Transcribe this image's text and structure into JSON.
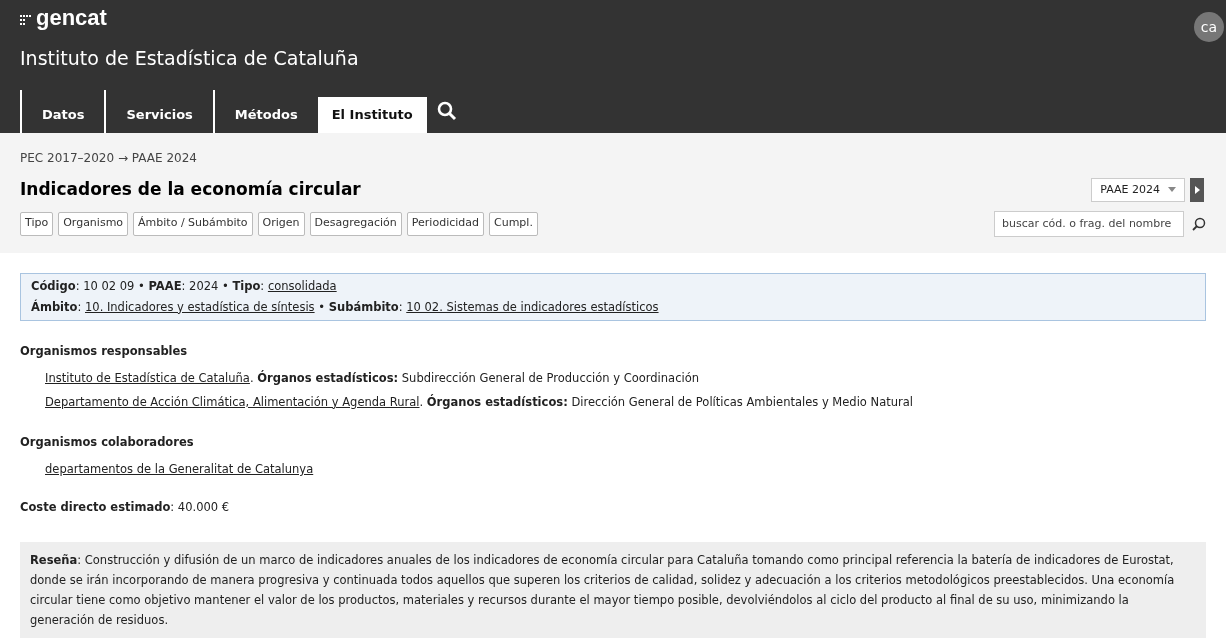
{
  "header": {
    "logo": "gencat",
    "title": "Instituto de Estadística de Cataluña",
    "language": "ca"
  },
  "nav": [
    {
      "label": "Datos",
      "selected": false
    },
    {
      "label": "Servicios",
      "selected": false
    },
    {
      "label": "Métodos",
      "selected": false
    },
    {
      "label": "El Instituto",
      "selected": true
    }
  ],
  "breadcrumb": "PEC 2017–2020 → PAAE 2024",
  "page_title": "Indicadores de la economía circular",
  "plan_select": {
    "value": "PAAE 2024"
  },
  "filters": [
    "Tipo",
    "Organismo",
    "Ámbito / Subámbito",
    "Origen",
    "Desagregación",
    "Periodicidad",
    "Cumpl."
  ],
  "search": {
    "placeholder": "buscar cód. o frag. del nombre"
  },
  "info_box": [
    [
      {
        "kind": "text",
        "text": "**Código**: 10 02 09 • **PAAE**: 2024 • **Tipo**: "
      },
      {
        "kind": "link",
        "text": "consolidada"
      }
    ],
    [
      {
        "kind": "text",
        "text": "**Ámbito**: "
      },
      {
        "kind": "link",
        "text": "10. Indicadores y estadística de síntesis"
      },
      {
        "kind": "text",
        "text": " • **Subámbito**: "
      },
      {
        "kind": "link",
        "text": "10 02. Sistemas de indicadores estadísticos"
      }
    ]
  ],
  "sections": [
    {
      "heading": "Organismos responsables",
      "items": [
        {
          "link": "Instituto de Estadística de Cataluña",
          "text": ". **Órganos estadísticos:** Subdirección General de Producción y Coordinación"
        },
        {
          "link": "Departamento de Acción Climática, Alimentación y Agenda Rural",
          "text": ". **Órganos estadísticos:** Dirección General de Políticas Ambientales y Medio Natural"
        }
      ]
    },
    {
      "heading": "Organismos colaboradores",
      "items": [
        {
          "link": "departamentos de la Generalitat de Catalunya"
        }
      ]
    }
  ],
  "cost": "**Coste directo estimado**: 40.000 €",
  "summary": "**Reseña**: Construcción y difusión de un marco de indicadores anuales de los indicadores de economía circular para Cataluña tomando como principal referencia la batería de indicadores de Eurostat, donde se irán incorporando de manera progresiva y continuada todos aquellos que superen los criterios de calidad, solidez y adecuación a los criterios metodológicos preestablecidos. Una economía circular tiene como objetivo mantener el valor de los productos, materiales y recursos durante el mayor tiempo posible, devolviéndolos al ciclo del producto al final de su uso, minimizando la generación de residuos."
}
